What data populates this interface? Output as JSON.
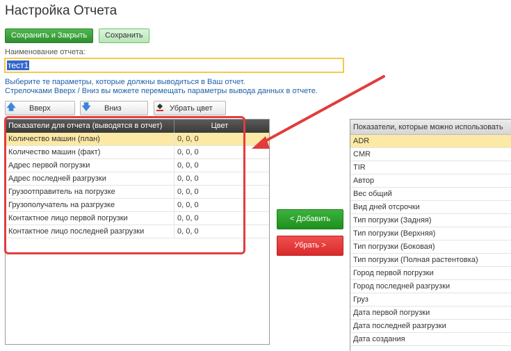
{
  "window": {
    "title": "Настройка Отчета"
  },
  "toolbar": {
    "save_close_label": "Сохранить и Закрыть",
    "save_label": "Сохранить"
  },
  "report_name": {
    "label": "Наименование отчета:",
    "value": "тест1"
  },
  "hints": [
    "Выберите те параметры, которые должны выводиться в Ваш отчет.",
    "Стрелочками Вверх / Вниз вы можете перемещать параметры вывода данных в отчете."
  ],
  "actions": {
    "up_label": "Вверх",
    "down_label": "Вниз",
    "remove_color_label": "Убрать цвет"
  },
  "selected_grid": {
    "columns": [
      "Показатели для отчета (выводятся в отчет)",
      "Цвет"
    ],
    "rows": [
      [
        "Количество машин (план)",
        "0, 0, 0"
      ],
      [
        "Количество машин (факт)",
        "0, 0, 0"
      ],
      [
        "Адрес первой погрузки",
        "0, 0, 0"
      ],
      [
        "Адрес последней разгрузки",
        "0, 0, 0"
      ],
      [
        "Грузоотправитель на погрузке",
        "0, 0, 0"
      ],
      [
        "Грузополучатель на разгрузке",
        "0, 0, 0"
      ],
      [
        "Контактное лицо первой погрузки",
        "0, 0, 0"
      ],
      [
        "Контактное лицо последней разгрузки",
        "0, 0, 0"
      ]
    ],
    "selected_index": 0
  },
  "transfer": {
    "add_label": "< Добавить",
    "remove_label": "Убрать >"
  },
  "available_grid": {
    "column": "Показатели, которые можно использовать",
    "items": [
      "ADR",
      "CMR",
      "TIR",
      "Автор",
      "Вес общий",
      "Вид дней отсрочки",
      "Тип погрузки (Задняя)",
      "Тип погрузки (Верхняя)",
      "Тип погрузки (Боковая)",
      "Тип погрузки (Полная растентовка)",
      "Город первой погрузки",
      "Город последней разгрузки",
      "Груз",
      "Дата первой погрузки",
      "Дата последней разгрузки",
      "Дата создания"
    ],
    "selected_index": 0
  },
  "colors": {
    "accent_green": "#2e8f2e",
    "accent_red": "#d92a2a",
    "highlight": "#fbe9a5",
    "annotation": "#e23c3c"
  }
}
